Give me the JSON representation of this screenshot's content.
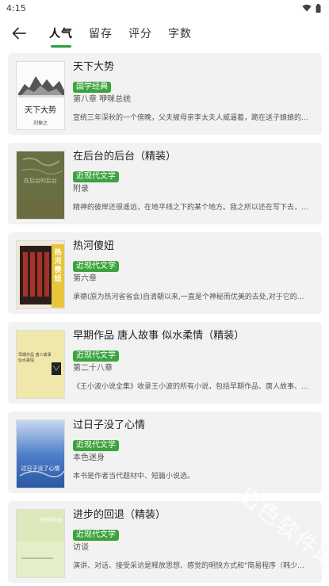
{
  "status_bar": {
    "time": "4:15"
  },
  "header": {
    "tabs": [
      {
        "label": "人气"
      },
      {
        "label": "留存"
      },
      {
        "label": "评分"
      },
      {
        "label": "字数"
      }
    ]
  },
  "books": [
    {
      "title": "天下大势",
      "tag": "国学经典",
      "chapter": "第八章 咿咪总统",
      "desc": "宣统三年深秋的一个傍晚，父夫被母亲李太夫人威逼着，跪在送子娘娘的...",
      "cover_title": "天下大势",
      "cover_sub": "刘振之"
    },
    {
      "title": "在后台的后台（精装）",
      "tag": "近现代文学",
      "chapter": "附录",
      "desc": "精神的彼岸还很遥远，在地平线之下的某个地方。我之所以还在写下去，...",
      "cover_title": "在后台的后台"
    },
    {
      "title": "热河傻妞",
      "tag": "近现代文学",
      "chapter": "第六章",
      "desc": "承德(原为热河省省会)自清朝以来,一直是个神秘而优美的去处,对于它的...",
      "cover_title": "热河傻妞"
    },
    {
      "title": "早期作品 唐人故事 似水柔情（精装）",
      "tag": "近现代文学",
      "chapter": "第二十八章",
      "desc": "《王小波小说全集》收录王小波的所有小说，包括早期作品、唐人故事、...",
      "cover_title": "早期作品 唐人故事 似水柔情"
    },
    {
      "title": "过日子没了心情",
      "tag": "近现代文学",
      "chapter": "本色迷身",
      "desc": "本书是作者当代题材中、短篇小说选。",
      "cover_title": "过日子没了心情"
    },
    {
      "title": "进步的回退（精装）",
      "tag": "近现代文学",
      "chapter": "访谈",
      "desc": "演讲、对话、接受采访是释放思想、感觉的明快方式和\"简易程序（韩少...",
      "cover_title": "进步的回退"
    }
  ],
  "watermark": "出色软件站",
  "colors": {
    "accent": "#2e9e3c",
    "tag": "#3ca33f",
    "card_bg": "#f2f2f2"
  }
}
